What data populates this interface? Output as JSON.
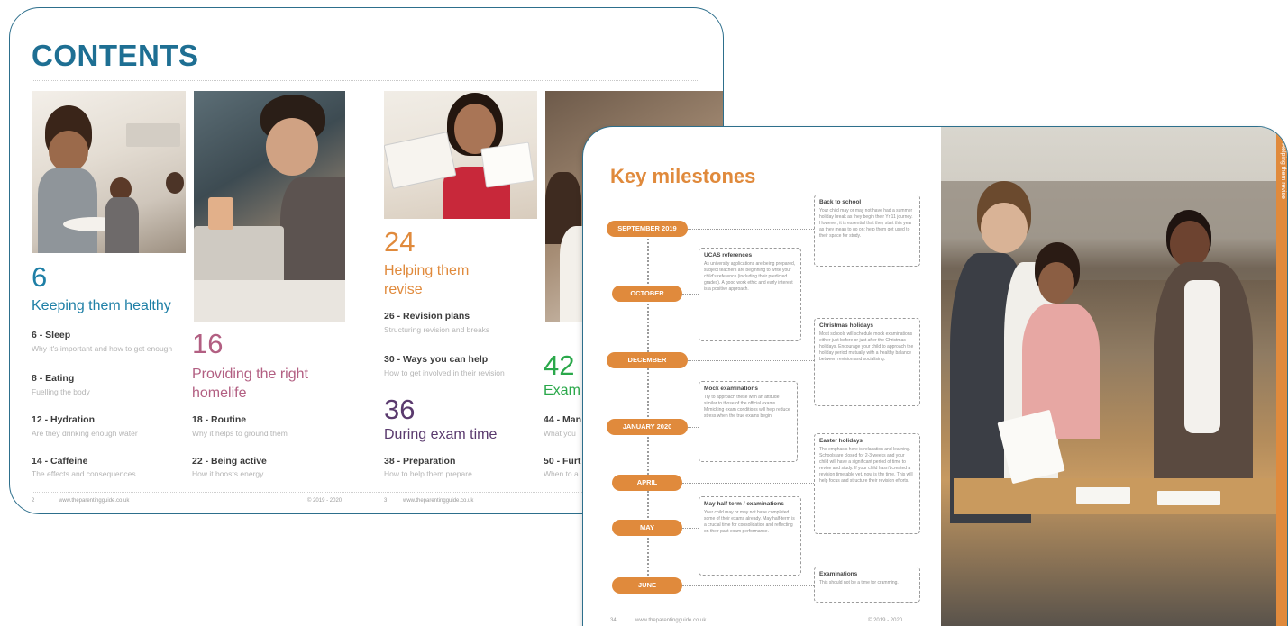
{
  "contents_page": {
    "title": "CONTENTS",
    "sections": [
      {
        "number": "6",
        "title": "Keeping them healthy",
        "color": "#1e7fa6",
        "entries": [
          {
            "title": "6 - Sleep",
            "desc": "Why it's important and how to get enough"
          },
          {
            "title": "8 - Eating",
            "desc": "Fuelling the body"
          },
          {
            "title": "12 - Hydration",
            "desc": "Are they drinking enough water"
          },
          {
            "title": "14 - Caffeine",
            "desc": "The effects and consequences"
          }
        ]
      },
      {
        "number": "16",
        "title": "Providing the right homelife",
        "color": "#b25f82",
        "entries": [
          {
            "title": "18 - Routine",
            "desc": "Why it helps to ground them"
          },
          {
            "title": "22 - Being active",
            "desc": "How it boosts energy"
          }
        ]
      },
      {
        "number": "24",
        "title": "Helping them revise",
        "color": "#e08a3c",
        "entries": [
          {
            "title": "26 - Revision plans",
            "desc": "Structuring revision and breaks"
          },
          {
            "title": "30 - Ways you can help",
            "desc": "How to get involved in their revision"
          }
        ]
      },
      {
        "number": "36",
        "title": "During exam time",
        "color": "#5a3a6e",
        "entries": [
          {
            "title": "38 - Preparation",
            "desc": "How to help them prepare"
          }
        ]
      },
      {
        "number": "42",
        "title": "Exam",
        "color": "#2aa84a",
        "entries": [
          {
            "title": "44 - Man",
            "desc": "What you"
          },
          {
            "title": "50 - Furt",
            "desc": "When to a"
          }
        ]
      }
    ],
    "footer": {
      "left_page": "2",
      "left_url": "www.theparentingguide.co.uk",
      "left_copyright": "© 2019 - 2020",
      "right_page": "3",
      "right_url": "www.theparentingguide.co.uk"
    }
  },
  "milestones_page": {
    "title": "Key milestones",
    "months": [
      "SEPTEMBER 2019",
      "OCTOBER",
      "DECEMBER",
      "JANUARY 2020",
      "APRIL",
      "MAY",
      "JUNE"
    ],
    "boxes": [
      {
        "title": "Back to school",
        "text": "Your child may or may not have had a summer holiday break as they begin their Yr 11 journey. However, it is essential that they start this year as they mean to go on; help them get used to their space for study."
      },
      {
        "title": "UCAS references",
        "text": "As university applications are being prepared, subject teachers are beginning to write your child's reference (including their predicted grades). A good work ethic and early interest is a positive approach."
      },
      {
        "title": "Christmas holidays",
        "text": "Most schools will schedule mock examinations either just before or just after the Christmas holidays. Encourage your child to approach the holiday period mutually with a healthy balance between revision and socialising."
      },
      {
        "title": "Mock examinations",
        "text": "Try to approach these with an attitude similar to those of the official exams. Mimicking exam conditions will help reduce stress when the true exams begin."
      },
      {
        "title": "Easter holidays",
        "text": "The emphasis here is relaxation and learning. Schools are closed for 2-3 weeks and your child will have a significant period of time to revise and study. If your child hasn't created a revision timetable yet, now is the time. This will help focus and structure their revision efforts."
      },
      {
        "title": "May half term / examinations",
        "text": "Your child may or may not have completed some of their exams already. May half-term is a crucial time for consolidation and reflecting on their past exam performance."
      },
      {
        "title": "Examinations",
        "text": "This should not be a time for cramming."
      }
    ],
    "side_tab": "Helping them revise",
    "footer": {
      "page": "34",
      "url": "www.theparentingguide.co.uk",
      "copyright": "© 2019 - 2020"
    }
  }
}
